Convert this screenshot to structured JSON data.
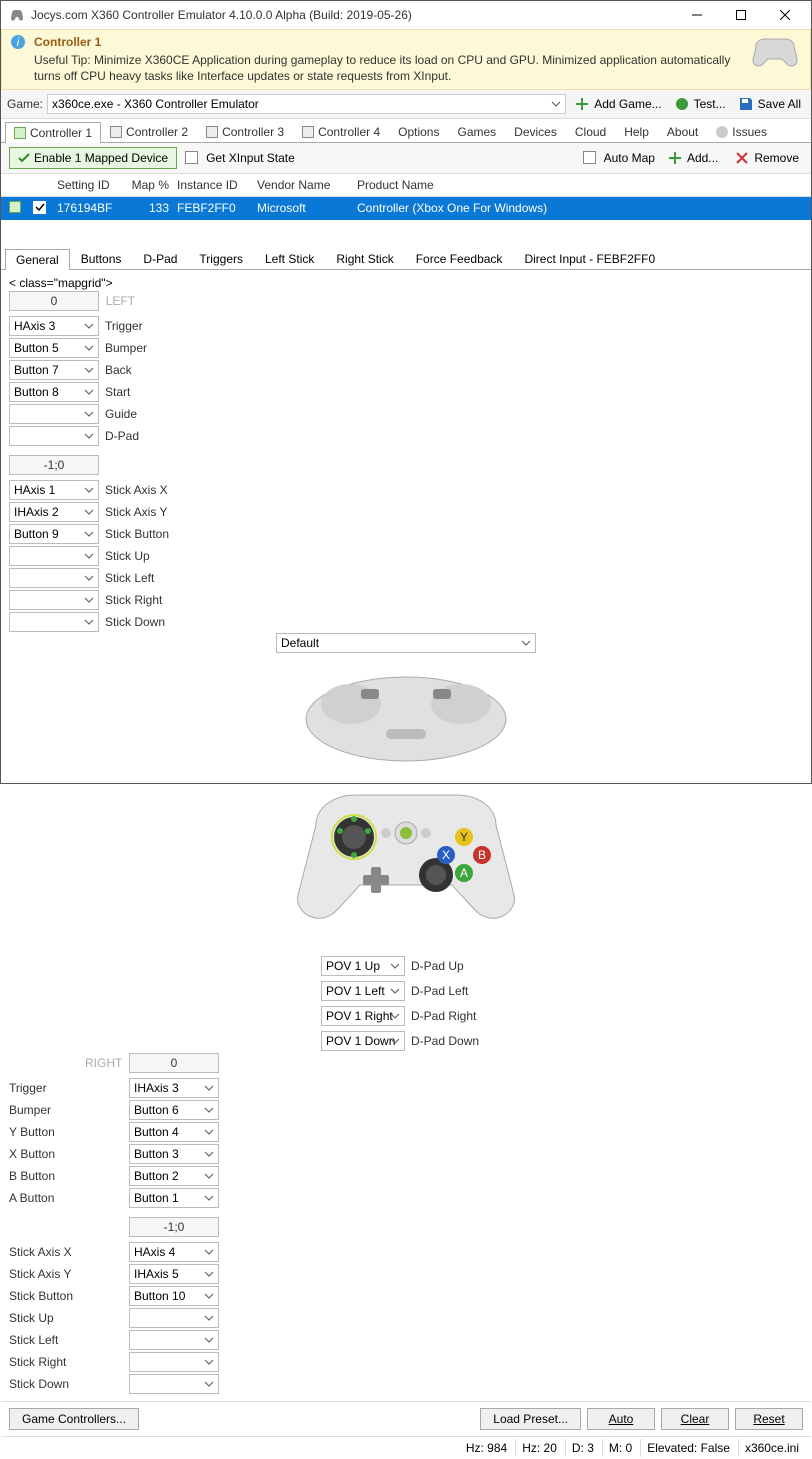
{
  "window": {
    "title": "Jocys.com X360 Controller Emulator 4.10.0.0 Alpha (Build: 2019-05-26)"
  },
  "tip": {
    "header": "Controller 1",
    "text": "Useful Tip: Minimize X360CE Application during gameplay to reduce its load on CPU and GPU. Minimized application automatically turns off CPU heavy tasks like Interface updates or state requests from XInput."
  },
  "toolbar": {
    "game_label": "Game:",
    "game_value": "x360ce.exe - X360 Controller Emulator",
    "add_game": "Add Game...",
    "test": "Test...",
    "save_all": "Save All"
  },
  "main_tabs": [
    "Controller 1",
    "Controller 2",
    "Controller 3",
    "Controller 4",
    "Options",
    "Games",
    "Devices",
    "Cloud",
    "Help",
    "About",
    "Issues"
  ],
  "actions": {
    "enable": "Enable 1 Mapped Device",
    "get_state": "Get XInput State",
    "automap": "Auto Map",
    "add": "Add...",
    "remove": "Remove"
  },
  "dev_cols": {
    "sid": "Setting ID",
    "map": "Map %",
    "iid": "Instance ID",
    "vn": "Vendor Name",
    "pn": "Product Name"
  },
  "dev_row": {
    "sid": "176194BF",
    "map": "133",
    "iid": "FEBF2FF0",
    "vn": "Microsoft",
    "pn": "Controller (Xbox One For Windows)"
  },
  "sub_tabs": [
    "General",
    "Buttons",
    "D-Pad",
    "Triggers",
    "Left Stick",
    "Right Stick",
    "Force Feedback",
    "Direct Input - FEBF2FF0"
  ],
  "map": {
    "preset": "Default",
    "left_header": "LEFT",
    "right_header": "RIGHT",
    "left_value_top": "0",
    "right_value_top": "0",
    "left_value_mid": "-1;0",
    "right_value_mid": "-1;0",
    "L": [
      {
        "label": "Trigger",
        "value": "HAxis 3"
      },
      {
        "label": "Bumper",
        "value": "Button 5"
      },
      {
        "label": "Back",
        "value": "Button 7"
      },
      {
        "label": "Start",
        "value": "Button 8"
      },
      {
        "label": "Guide",
        "value": ""
      },
      {
        "label": "D-Pad",
        "value": ""
      }
    ],
    "L2": [
      {
        "label": "Stick Axis X",
        "value": "HAxis 1"
      },
      {
        "label": "Stick Axis Y",
        "value": "IHAxis 2"
      },
      {
        "label": "Stick Button",
        "value": "Button 9"
      },
      {
        "label": "Stick Up",
        "value": ""
      },
      {
        "label": "Stick Left",
        "value": ""
      },
      {
        "label": "Stick Right",
        "value": ""
      },
      {
        "label": "Stick Down",
        "value": ""
      }
    ],
    "R": [
      {
        "label": "Trigger",
        "value": "IHAxis 3"
      },
      {
        "label": "Bumper",
        "value": "Button 6"
      },
      {
        "label": "Y Button",
        "value": "Button 4"
      },
      {
        "label": "X Button",
        "value": "Button 3"
      },
      {
        "label": "B Button",
        "value": "Button 2"
      },
      {
        "label": "A Button",
        "value": "Button 1"
      }
    ],
    "R2": [
      {
        "label": "Stick Axis X",
        "value": "HAxis 4"
      },
      {
        "label": "Stick Axis Y",
        "value": "IHAxis 5"
      },
      {
        "label": "Stick Button",
        "value": "Button 10"
      },
      {
        "label": "Stick Up",
        "value": ""
      },
      {
        "label": "Stick Left",
        "value": ""
      },
      {
        "label": "Stick Right",
        "value": ""
      },
      {
        "label": "Stick Down",
        "value": ""
      }
    ],
    "dpad": [
      {
        "label": "D-Pad Up",
        "value": "POV 1 Up"
      },
      {
        "label": "D-Pad Left",
        "value": "POV 1 Left"
      },
      {
        "label": "D-Pad Right",
        "value": "POV 1 Right"
      },
      {
        "label": "D-Pad Down",
        "value": "POV 1 Down"
      }
    ]
  },
  "bottom": {
    "game_ctrl": "Game Controllers...",
    "load": "Load Preset...",
    "auto": "Auto",
    "clear": "Clear",
    "reset": "Reset"
  },
  "status": {
    "hz1": "Hz: 984",
    "hz2": "Hz: 20",
    "d": "D: 3",
    "m": "M: 0",
    "elev": "Elevated: False",
    "ini": "x360ce.ini"
  }
}
